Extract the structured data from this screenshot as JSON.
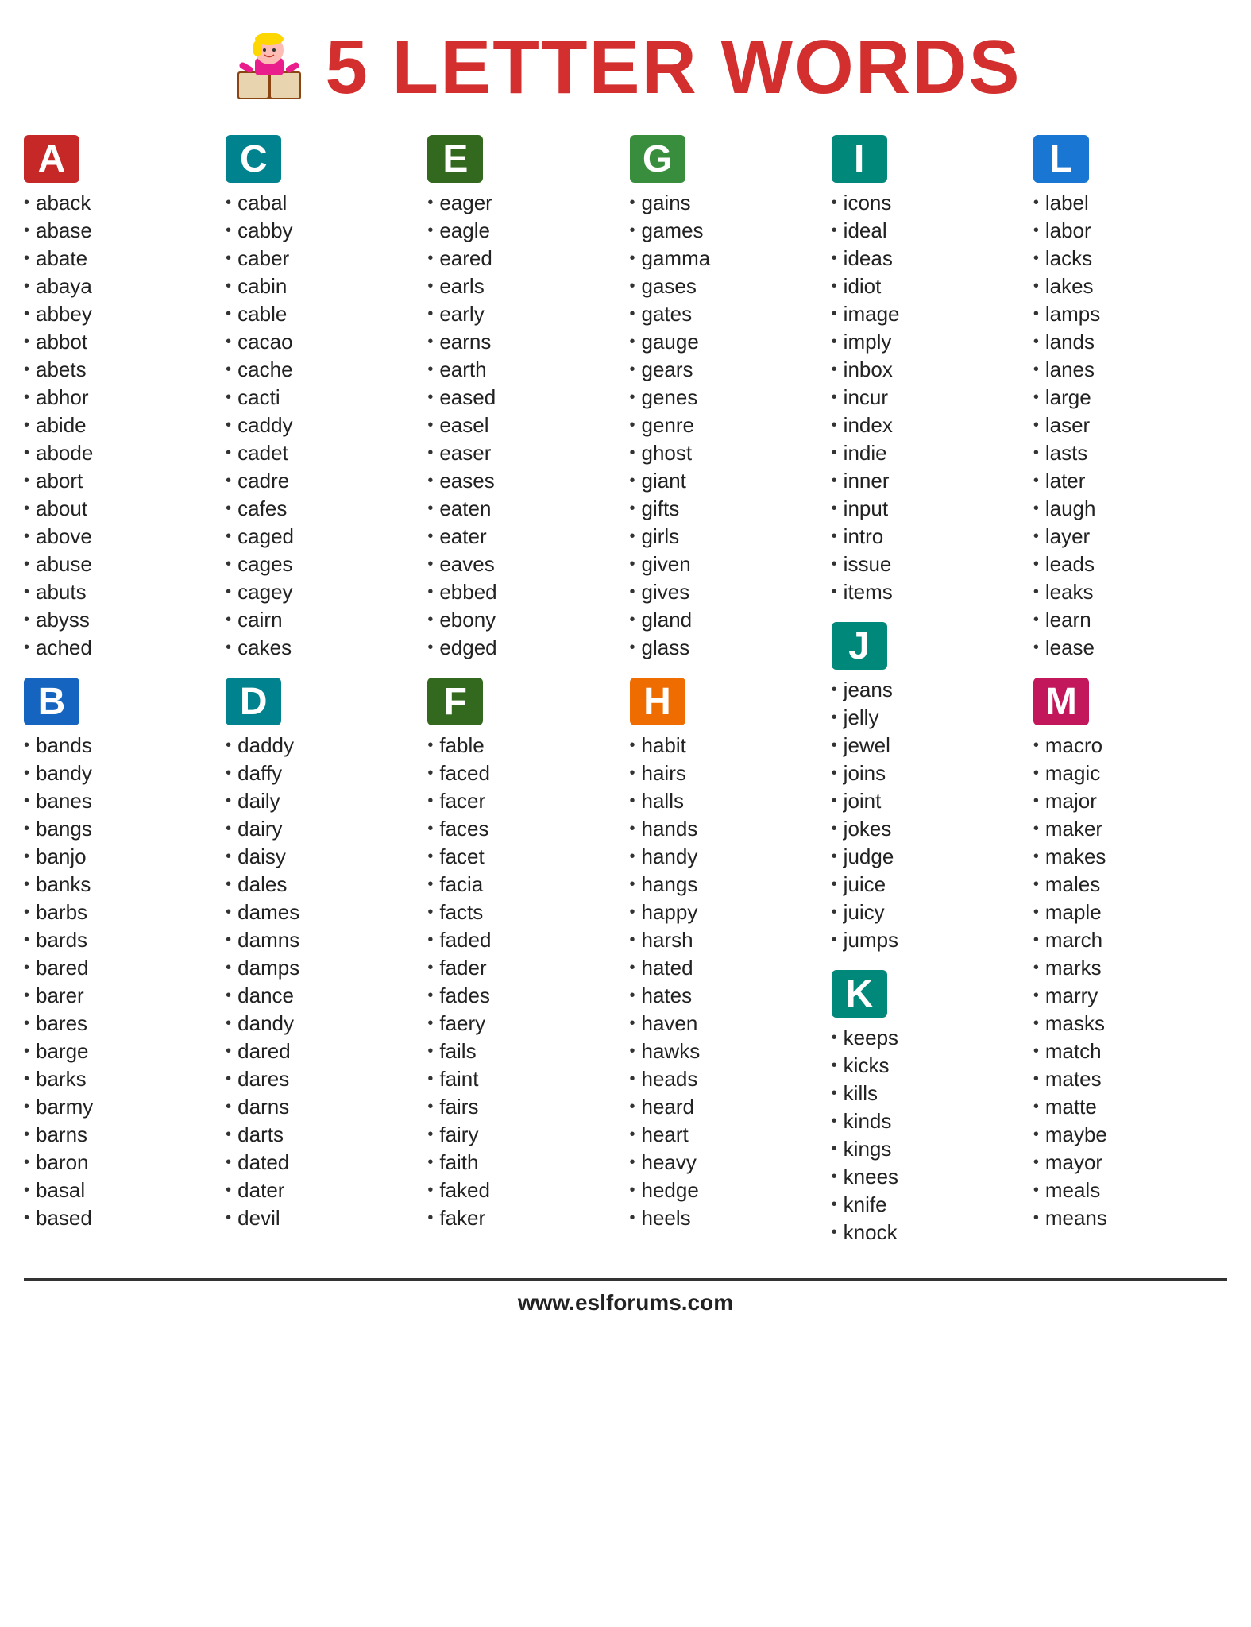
{
  "header": {
    "title": "5 LETTER WORDS",
    "website": "www.eslforums.com"
  },
  "sections": [
    {
      "letter": "A",
      "badgeClass": "badge-red",
      "words": [
        "aback",
        "abase",
        "abate",
        "abaya",
        "abbey",
        "abbot",
        "abets",
        "abhor",
        "abide",
        "abode",
        "abort",
        "about",
        "above",
        "abuse",
        "abuts",
        "abyss",
        "ached"
      ]
    },
    {
      "letter": "C",
      "badgeClass": "badge-teal",
      "words": [
        "cabal",
        "cabby",
        "caber",
        "cabin",
        "cable",
        "cacao",
        "cache",
        "cacti",
        "caddy",
        "cadet",
        "cadre",
        "cafes",
        "caged",
        "cages",
        "cagey",
        "cairn",
        "cakes"
      ]
    },
    {
      "letter": "E",
      "badgeClass": "badge-green-dark",
      "words": [
        "eager",
        "eagle",
        "eared",
        "earls",
        "early",
        "earns",
        "earth",
        "eased",
        "easel",
        "easer",
        "eases",
        "eaten",
        "eater",
        "eaves",
        "ebbed",
        "ebony",
        "edged"
      ]
    },
    {
      "letter": "G",
      "badgeClass": "badge-green",
      "words": [
        "gains",
        "games",
        "gamma",
        "gases",
        "gates",
        "gauge",
        "gears",
        "genes",
        "genre",
        "ghost",
        "giant",
        "gifts",
        "girls",
        "given",
        "gives",
        "gland",
        "glass"
      ]
    },
    {
      "letter": "I",
      "badgeClass": "badge-teal2",
      "words": [
        "icons",
        "ideal",
        "ideas",
        "idiot",
        "image",
        "imply",
        "inbox",
        "incur",
        "index",
        "indie",
        "inner",
        "input",
        "intro",
        "issue",
        "items"
      ]
    },
    {
      "letter": "L",
      "badgeClass": "badge-blue",
      "words": [
        "label",
        "labor",
        "lacks",
        "lakes",
        "lamps",
        "lands",
        "lanes",
        "large",
        "laser",
        "lasts",
        "later",
        "laugh",
        "layer",
        "leads",
        "leaks",
        "learn",
        "lease"
      ]
    },
    {
      "letter": "B",
      "badgeClass": "badge-blue-dark",
      "words": [
        "bands",
        "bandy",
        "banes",
        "bangs",
        "banjo",
        "banks",
        "barbs",
        "bards",
        "bared",
        "barer",
        "bares",
        "barge",
        "barks",
        "barmy",
        "barns",
        "baron",
        "basal",
        "based"
      ]
    },
    {
      "letter": "D",
      "badgeClass": "badge-teal",
      "words": [
        "daddy",
        "daffy",
        "daily",
        "dairy",
        "daisy",
        "dales",
        "dames",
        "damns",
        "damps",
        "dance",
        "dandy",
        "dared",
        "dares",
        "darns",
        "darts",
        "dated",
        "dater",
        "devil"
      ]
    },
    {
      "letter": "F",
      "badgeClass": "badge-green-dark",
      "words": [
        "fable",
        "faced",
        "facer",
        "faces",
        "facet",
        "facia",
        "facts",
        "faded",
        "fader",
        "fades",
        "faery",
        "fails",
        "faint",
        "fairs",
        "fairy",
        "faith",
        "faked",
        "faker"
      ]
    },
    {
      "letter": "H",
      "badgeClass": "badge-orange",
      "words": [
        "habit",
        "hairs",
        "halls",
        "hands",
        "handy",
        "hangs",
        "happy",
        "harsh",
        "hated",
        "hates",
        "haven",
        "hawks",
        "heads",
        "heard",
        "heart",
        "heavy",
        "hedge",
        "heels"
      ]
    },
    {
      "letter": "J",
      "badgeClass": "badge-teal2",
      "words": [
        "jeans",
        "jelly",
        "jewel",
        "joins",
        "joint",
        "jokes",
        "judge",
        "juice",
        "juicy",
        "jumps"
      ]
    },
    {
      "letter": "M",
      "badgeClass": "badge-magenta",
      "words": [
        "macro",
        "magic",
        "major",
        "maker",
        "makes",
        "males",
        "maple",
        "march",
        "marks",
        "marry",
        "masks",
        "match",
        "mates",
        "matte",
        "maybe",
        "mayor",
        "meals",
        "means"
      ]
    },
    {
      "letter": "K",
      "badgeClass": "badge-teal2",
      "words": [
        "keeps",
        "kicks",
        "kills",
        "kinds",
        "kings",
        "knees",
        "knife",
        "knock"
      ]
    }
  ],
  "layout": {
    "col1": [
      0,
      6
    ],
    "col2": [
      1,
      7
    ],
    "col3": [
      2,
      8
    ],
    "col4": [
      3,
      9
    ],
    "col5": [
      4,
      10,
      12
    ],
    "col6": [
      5,
      11
    ]
  }
}
